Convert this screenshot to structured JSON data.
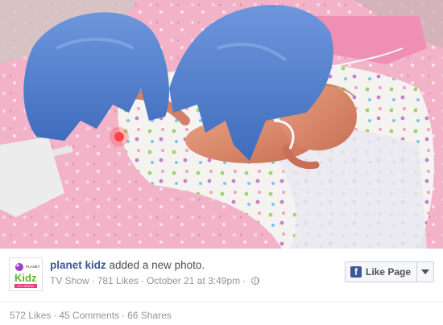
{
  "post": {
    "author": "planet kidz",
    "action": "added a new photo.",
    "category": "TV Show",
    "likes_count": "781 Likes",
    "date": "October 21 at 3:49pm",
    "privacy_icon": "globe-icon"
  },
  "like_page_button": {
    "label": "Like Page",
    "icon": "facebook-f-icon",
    "dropdown_icon": "chevron-down-icon"
  },
  "stats": {
    "likes": "572 Likes",
    "comments": "45 Comments",
    "shares": "66 Shares"
  },
  "avatar": {
    "logo_top": "PLANET",
    "logo_main": "Kidz",
    "logo_bottom": "TOY WORLD"
  },
  "colors": {
    "link": "#3b5998",
    "muted": "#90949c",
    "text": "#4b4f56",
    "glove": "#4d7fd0",
    "blanket": "#f4a7c4"
  }
}
